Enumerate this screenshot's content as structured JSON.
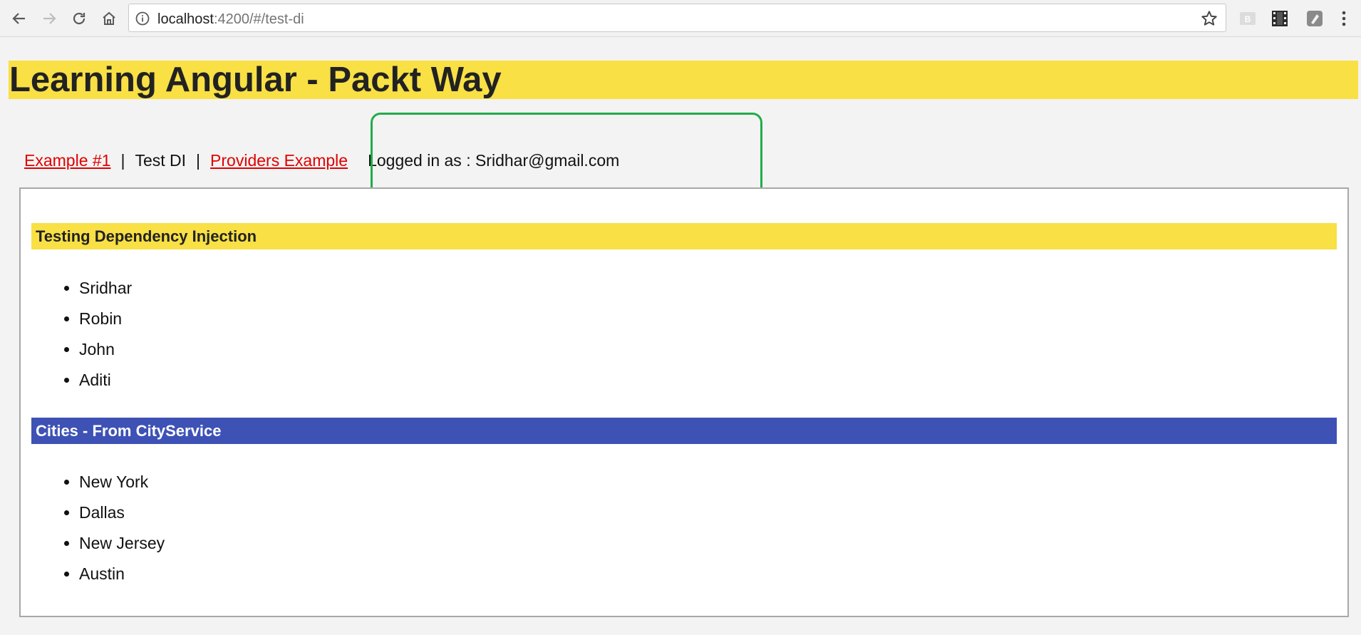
{
  "browser": {
    "url_host": "localhost",
    "url_path": ":4200/#/test-di",
    "icons": [
      "back-icon",
      "forward-icon",
      "reload-icon",
      "home-icon",
      "info-icon",
      "star-icon",
      "extension-icon",
      "filmstrip-icon",
      "extension-icon",
      "menu-icon"
    ]
  },
  "page": {
    "title": "Learning Angular - Packt Way",
    "nav": {
      "link1": "Example #1",
      "separator": "|",
      "current": "Test DI",
      "link2": "Providers Example",
      "logged_in": "Logged in as : Sridhar@gmail.com"
    },
    "sections": {
      "users": {
        "heading": "Testing Dependency Injection",
        "items": [
          "Sridhar",
          "Robin",
          "John",
          "Aditi"
        ]
      },
      "cities": {
        "heading": "Cities - From CityService",
        "items": [
          "New York",
          "Dallas",
          "New Jersey",
          "Austin"
        ]
      }
    }
  },
  "colors": {
    "banner": "#f8e045",
    "cities_header": "#3e51b5",
    "link": "#e00000",
    "highlight_box": "#1fad4a"
  }
}
